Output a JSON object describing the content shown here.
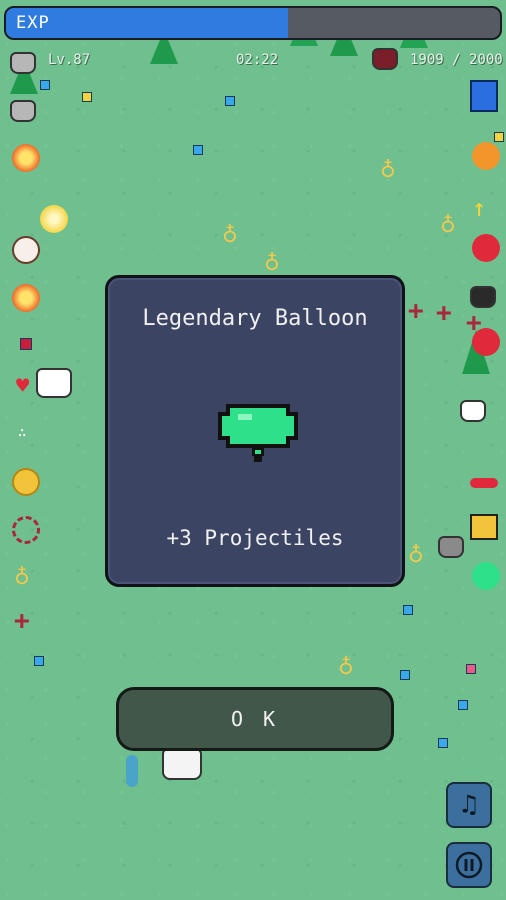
{
  "hud": {
    "exp_label": "EXP",
    "exp_progress": 0.57,
    "level": "Lv.87",
    "timer": "02:22",
    "hp": "1909 / 2000"
  },
  "dialog": {
    "title": "Legendary Balloon",
    "item_icon": "balloon-icon",
    "description": "+3 Projectiles"
  },
  "ok_button": {
    "label": "O K"
  },
  "controls": {
    "music_icon": "music-note-icon",
    "pause_icon": "pause-icon"
  },
  "colors": {
    "exp_fill": "#2f7be0",
    "dialog_bg": "#3b4463",
    "balloon": "#2fe08a",
    "grass": "#6fbf8f",
    "ok_bg": "#41574a"
  },
  "left_inventory": [
    "cat-icon",
    "cat-icon",
    "fireball-icon",
    "bomb-icon",
    "paw-icon",
    "fireball-icon",
    "gem-icon",
    "heart-icon",
    "dots-icon",
    "coin-icon",
    "target-ring-icon",
    "torch-icon",
    "cross-icon"
  ],
  "right_inventory": [
    "bucket-icon",
    "balloon-icon",
    "arrow-icon",
    "balloon-icon",
    "cat-icon",
    "balloon-icon",
    "bone-icon",
    "shorts-icon",
    "balloon-icon"
  ]
}
